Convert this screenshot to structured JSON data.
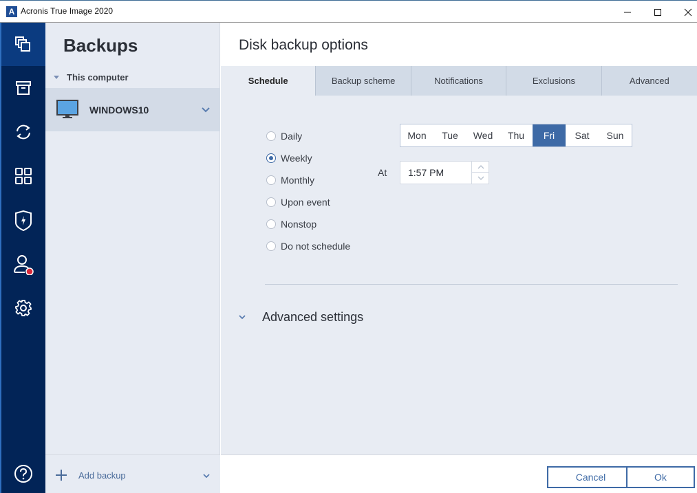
{
  "window": {
    "title": "Acronis True Image 2020",
    "logo_letter": "A",
    "controls": [
      "minimize",
      "maximize",
      "close"
    ]
  },
  "nav": {
    "items": [
      {
        "icon": "backup-icon",
        "active": true
      },
      {
        "icon": "archive-icon",
        "active": false
      },
      {
        "icon": "sync-icon",
        "active": false
      },
      {
        "icon": "tools-icon",
        "active": false
      },
      {
        "icon": "protection-shield-icon",
        "active": false
      },
      {
        "icon": "account-icon",
        "active": false,
        "badge": true
      },
      {
        "icon": "settings-gear-icon",
        "active": false
      }
    ],
    "help_icon": "help-icon"
  },
  "left_panel": {
    "title": "Backups",
    "section_label": "This computer",
    "backups": [
      {
        "name": "WINDOWS10",
        "icon": "monitor-icon"
      }
    ],
    "add_backup_label": "Add backup"
  },
  "main": {
    "title": "Disk backup options",
    "tabs": [
      {
        "label": "Schedule",
        "active": true
      },
      {
        "label": "Backup scheme",
        "active": false
      },
      {
        "label": "Notifications",
        "active": false
      },
      {
        "label": "Exclusions",
        "active": false
      },
      {
        "label": "Advanced",
        "active": false
      }
    ],
    "schedule": {
      "options": [
        {
          "label": "Daily",
          "checked": false
        },
        {
          "label": "Weekly",
          "checked": true
        },
        {
          "label": "Monthly",
          "checked": false
        },
        {
          "label": "Upon event",
          "checked": false
        },
        {
          "label": "Nonstop",
          "checked": false
        },
        {
          "label": "Do not schedule",
          "checked": false
        }
      ],
      "days": [
        {
          "label": "Mon",
          "selected": false
        },
        {
          "label": "Tue",
          "selected": false
        },
        {
          "label": "Wed",
          "selected": false
        },
        {
          "label": "Thu",
          "selected": false
        },
        {
          "label": "Fri",
          "selected": true
        },
        {
          "label": "Sat",
          "selected": false
        },
        {
          "label": "Sun",
          "selected": false
        }
      ],
      "at_label": "At",
      "time_value": "1:57 PM"
    },
    "advanced_settings_label": "Advanced settings",
    "buttons": {
      "cancel": "Cancel",
      "ok": "Ok"
    }
  },
  "colors": {
    "accent": "#3e6aa6",
    "nav_bg": "#022457",
    "nav_active": "#0b3b80",
    "badge": "#d9293a"
  }
}
